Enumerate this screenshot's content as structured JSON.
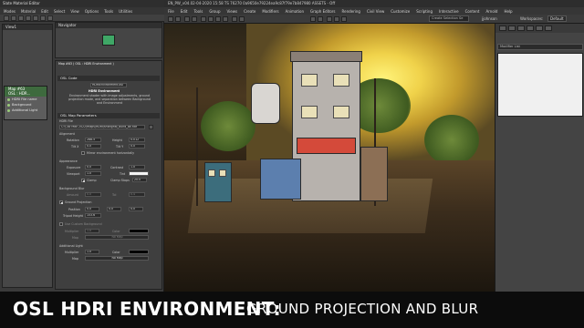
{
  "slate": {
    "title": "Slate Material Editor",
    "menus": [
      "Modes",
      "Material",
      "Edit",
      "Select",
      "View",
      "Options",
      "Tools",
      "Utilities"
    ],
    "view_label": "View1",
    "nav_label": "Navigator",
    "node": {
      "title_line1": "Map #63",
      "title_line2": "OSL : HDR...",
      "ports": [
        "HDRI File name",
        "Background",
        "Additional Light"
      ]
    },
    "params_title": "Map #63 ( OSL : HDRI Environment )",
    "osl_code_label": "OSL Code",
    "osl_file": "HDRIEnvironment.osl",
    "map_name": "HDRI Environment",
    "description": "Environment shader with image adjustments, ground projection mode, and separation between Background and Environment",
    "osl_params_label": "OSL Map Parameters",
    "hdri_label": "HDRI File",
    "hdri_path": "C:\\Cilo Max 2022\\maps\\HDRI\\shanghai_bund_8k.hdr",
    "alignment_label": "Alignment",
    "rotation_label": "Rotation",
    "rotation_value": "288.5",
    "height_label": "Height",
    "height_value": "0.012",
    "tilt_x_label": "Tilt X",
    "tilt_x_value": "0.0",
    "tilt_y_label": "Tilt Y",
    "tilt_y_value": "0.0",
    "mirror_label": "Mirror environment horizontally",
    "appearance_label": "Appearance",
    "exposure_label": "Exposure",
    "exposure_value": "0.0",
    "contrast_label": "Contrast",
    "contrast_value": "1.0",
    "viewport_label": "Viewport",
    "viewport_value": "1.0",
    "tint_label": "Tint",
    "clamp_label": "Clamp",
    "clamp_stops_label": "Clamp Stops",
    "clamp_stops_value": "20.0",
    "bg_blur_label": "Background Blur",
    "bg_blur_amount_label": "Amount",
    "bg_blur_amount_value": "0.0",
    "bg_blur_tol_label": "Tol",
    "bg_blur_tol_value": "0.4",
    "ground_proj_label": "Ground Projection",
    "position_label": "Position",
    "position_values": [
      "0.0",
      "0.0",
      "0.0"
    ],
    "tripod_label": "Tripod Height",
    "tripod_value": "153.6",
    "use_custom_bg_label": "Use Custom Background",
    "multiplier_label": "Multiplier",
    "multiplier_value": "1.0",
    "color_label": "Color",
    "map_label": "Map",
    "no_map": "No Map",
    "additional_light_label": "Additional Light",
    "al_multiplier_value": "1.0"
  },
  "max": {
    "title": "EN_PW_v04.02-04-2020 15:58 TS 76270 0a9650e79224ea9c87f79e7b847980 ASSETS - Off",
    "menus": [
      "File",
      "Edit",
      "Tools",
      "Group",
      "Views",
      "Create",
      "Modifiers",
      "Animation",
      "Graph Editors",
      "Rendering",
      "Civil View",
      "Customize",
      "Scripting",
      "Interactive",
      "Content",
      "Arnold",
      "Help"
    ],
    "selection_set": "Create Selection Se",
    "user": "jjohnson",
    "workspaces_label": "Workspaces:",
    "workspace": "Default"
  },
  "command_panel": {
    "modifier_list": "Modifier List"
  },
  "banner": {
    "bold": "OSL HDRI ENVIRONMENT:",
    "light": "GROUND PROJECTION AND BLUR"
  },
  "colors": {
    "node_header": "#3e6a3e",
    "preview_swatch": "#3fa766",
    "sky_glow": "#f0d24a"
  }
}
